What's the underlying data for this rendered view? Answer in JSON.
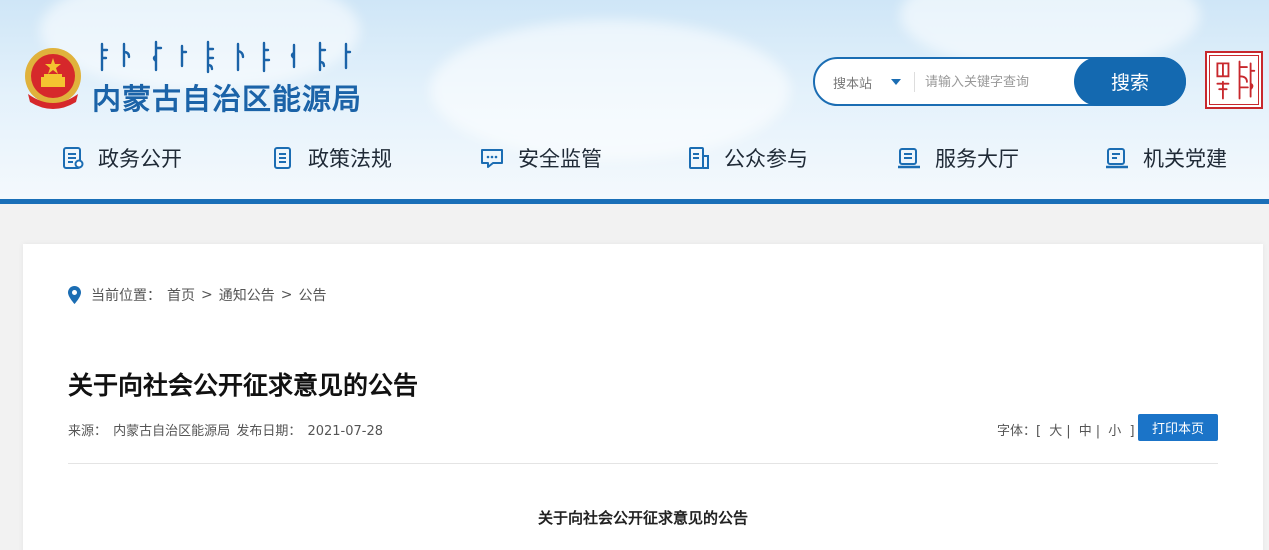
{
  "header": {
    "site_title": "内蒙古自治区能源局",
    "search": {
      "scope_label": "搜本站",
      "placeholder": "请输入关键字查询",
      "button_label": "搜索"
    },
    "colors": {
      "brand_blue": "#1b63a8",
      "accent_blue": "#1469b0",
      "seal_red": "#c8282d"
    }
  },
  "nav": {
    "items": [
      {
        "label": "政务公开",
        "icon": "document-list-icon"
      },
      {
        "label": "政策法规",
        "icon": "policy-book-icon"
      },
      {
        "label": "安全监管",
        "icon": "chat-bubble-icon"
      },
      {
        "label": "公众参与",
        "icon": "public-participation-icon"
      },
      {
        "label": "服务大厅",
        "icon": "service-hall-icon"
      },
      {
        "label": "机关党建",
        "icon": "party-building-icon"
      }
    ]
  },
  "breadcrumb": {
    "prefix": "当前位置：",
    "items": [
      "首页",
      "通知公告",
      "公告"
    ],
    "separator": ">"
  },
  "article": {
    "title": "关于向社会公开征求意见的公告",
    "source_label": "来源：",
    "source": "内蒙古自治区能源局",
    "date_label": "发布日期：",
    "date": "2021-07-28",
    "font_label": "字体：[",
    "font_options": [
      "大",
      "中",
      "小"
    ],
    "font_close": "]",
    "print_label": "打印本页",
    "content_heading": "关于向社会公开征求意见的公告"
  }
}
